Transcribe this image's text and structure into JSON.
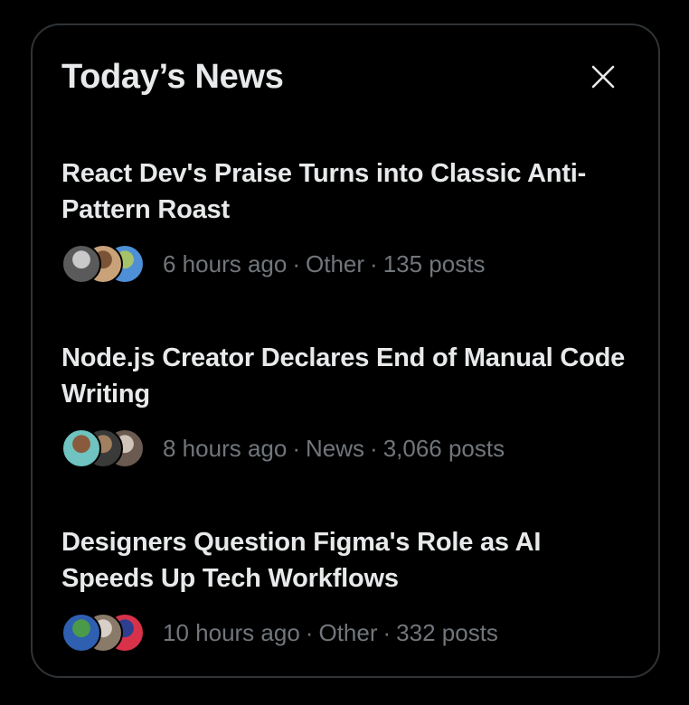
{
  "panel": {
    "title": "Today’s News",
    "close_icon": "close-icon"
  },
  "news": [
    {
      "headline": "React Dev's Praise Turns into Classic Anti-Pattern Roast",
      "time": "6 hours ago",
      "category": "Other",
      "posts": "135 posts",
      "avatar_colors": [
        [
          "#5a5a5a",
          "#c9c9c9"
        ],
        [
          "#c9a27a",
          "#7a5236"
        ],
        [
          "#4f8fd6",
          "#a6c36b"
        ]
      ]
    },
    {
      "headline": "Node.js Creator Declares End of Manual Code Writing",
      "time": "8 hours ago",
      "category": "News",
      "posts": "3,066 posts",
      "avatar_colors": [
        [
          "#6fc3c0",
          "#8a5a3c"
        ],
        [
          "#3a3a3a",
          "#a08060"
        ],
        [
          "#6a5a50",
          "#d0c4b8"
        ]
      ]
    },
    {
      "headline": "Designers Question Figma's Role as AI Speeds Up Tech Workflows",
      "time": "10 hours ago",
      "category": "Other",
      "posts": "332 posts",
      "avatar_colors": [
        [
          "#2f5fb0",
          "#4a9a4a"
        ],
        [
          "#8a7a6a",
          "#d8d0c8"
        ],
        [
          "#d8324a",
          "#2e3f8f"
        ]
      ]
    }
  ],
  "separator": "·"
}
